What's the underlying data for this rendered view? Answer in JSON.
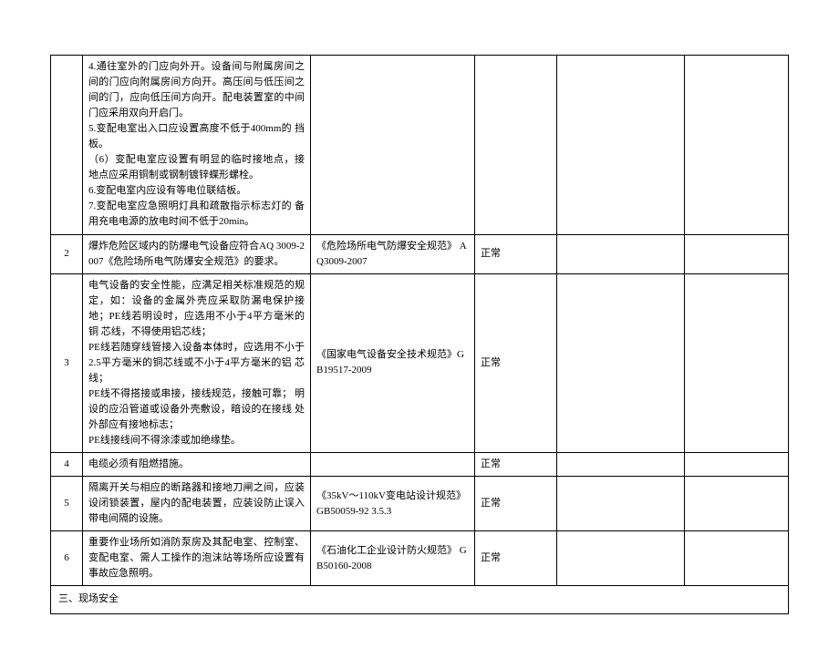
{
  "rows": [
    {
      "num": "",
      "desc": "4.通往室外的门应向外开。设备间与附属房间之间的门应向附属房间方向开。高压间与低压间之间的门，应向低压间方向开。配电装置室的中间门应采用双向开启门。\n5.变配电室出入口应设置高度不低于400mm的 挡板。\n（6）变配电室应设置有明显的临时接地点，接 地点应采用铜制或钢制镀锌蝶形螺栓。\n6.变配电室内应设有等电位联结板。\n7.变配电室应急照明灯具和疏散指示标志灯的 备用充电电源的放电时间不低于20min。",
      "ref": "",
      "status": ""
    },
    {
      "num": "2",
      "desc": "爆炸危险区域内的防爆电气设备应符合AQ 3009-2007《危险场所电气防爆安全规范》的要求。",
      "ref": "《危险场所电气防爆安全规范》 AQ3009-2007",
      "status": "正常"
    },
    {
      "num": "3",
      "desc": "电气设备的安全性能，应满足相关标准规范的规定，如：设备的金属外壳应采取防漏电保护接地；PE线若明设时，应选用不小于4平方毫米的铜 芯线，不得使用铝芯线；\nPE线若随穿线管接入设备本体时，应选用不小于2.5平方毫米的铜芯线或不小于4平方毫米的铝 芯线；\nPE线不得搭接或串接，接线规范，接触可靠； 明设的应沿管道或设备外壳敷设，暗设的在接线 处外部应有接地标志；\nPE线接线间不得涂漆或加绝缘垫。",
      "ref": "《国家电气设备安全技术规范》GB19517-2009",
      "status": "正常"
    },
    {
      "num": "4",
      "desc": "电缆必须有阻燃措施。",
      "ref": "",
      "status": "正常"
    },
    {
      "num": "5",
      "desc": "隔离开关与相应的断路器和接地刀闸之间，应装设闭锁装置，屋内的配电装置，应装设防止误入带电间隔的设施。",
      "ref": "《35kV～110kV变电站设计规范》GB50059-92 3.5.3",
      "status": "正常"
    },
    {
      "num": "6",
      "desc": "重要作业场所如消防泵房及其配电室、控制室、变配电室、需人工操作的泡沫站等场所应设置有事故应急照明。",
      "ref": "《石油化工企业设计防火规范》 GB50160-2008",
      "status": "正常"
    }
  ],
  "section_footer": "三、现场安全"
}
